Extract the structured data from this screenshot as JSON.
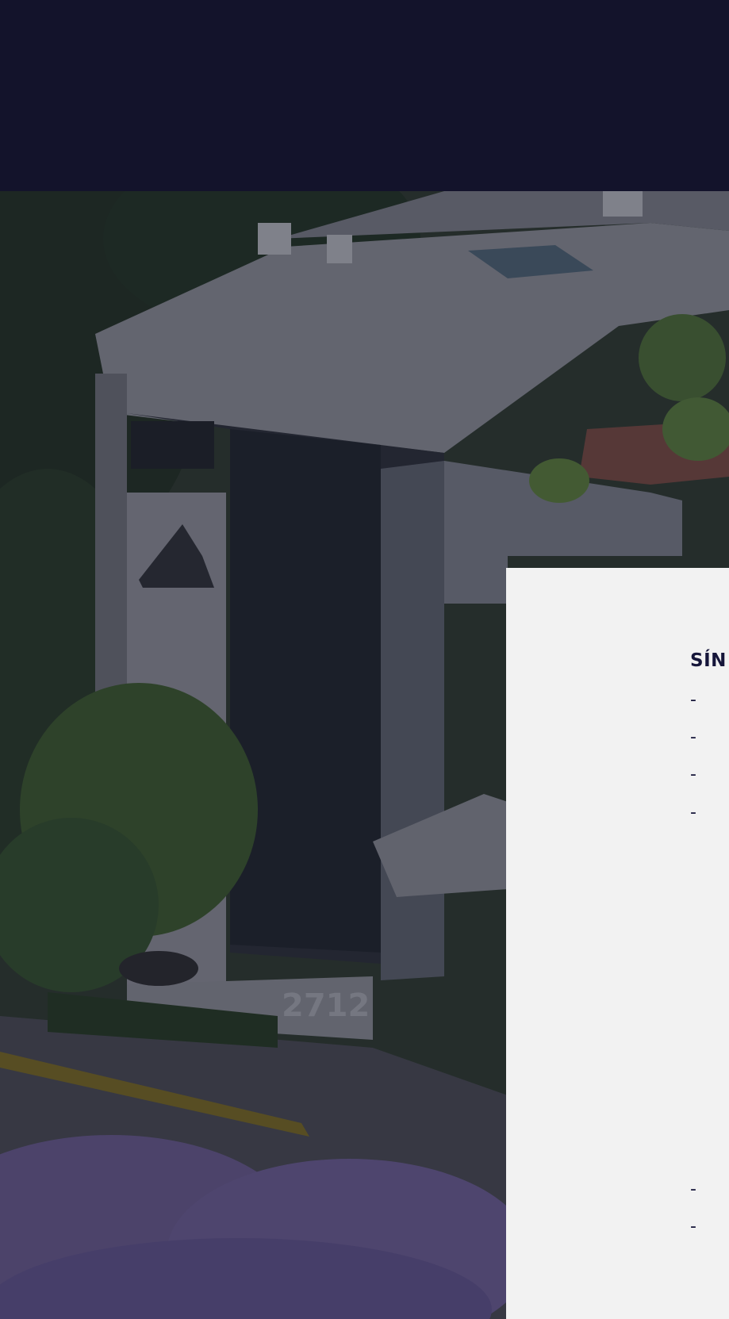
{
  "header": {
    "background": "#13132b"
  },
  "hero": {
    "building_number": "2712"
  },
  "card": {
    "title": "SÍN",
    "list_markers": [
      "-",
      "-",
      "-",
      "-",
      "-",
      "-"
    ],
    "title_color": "#16163a"
  }
}
